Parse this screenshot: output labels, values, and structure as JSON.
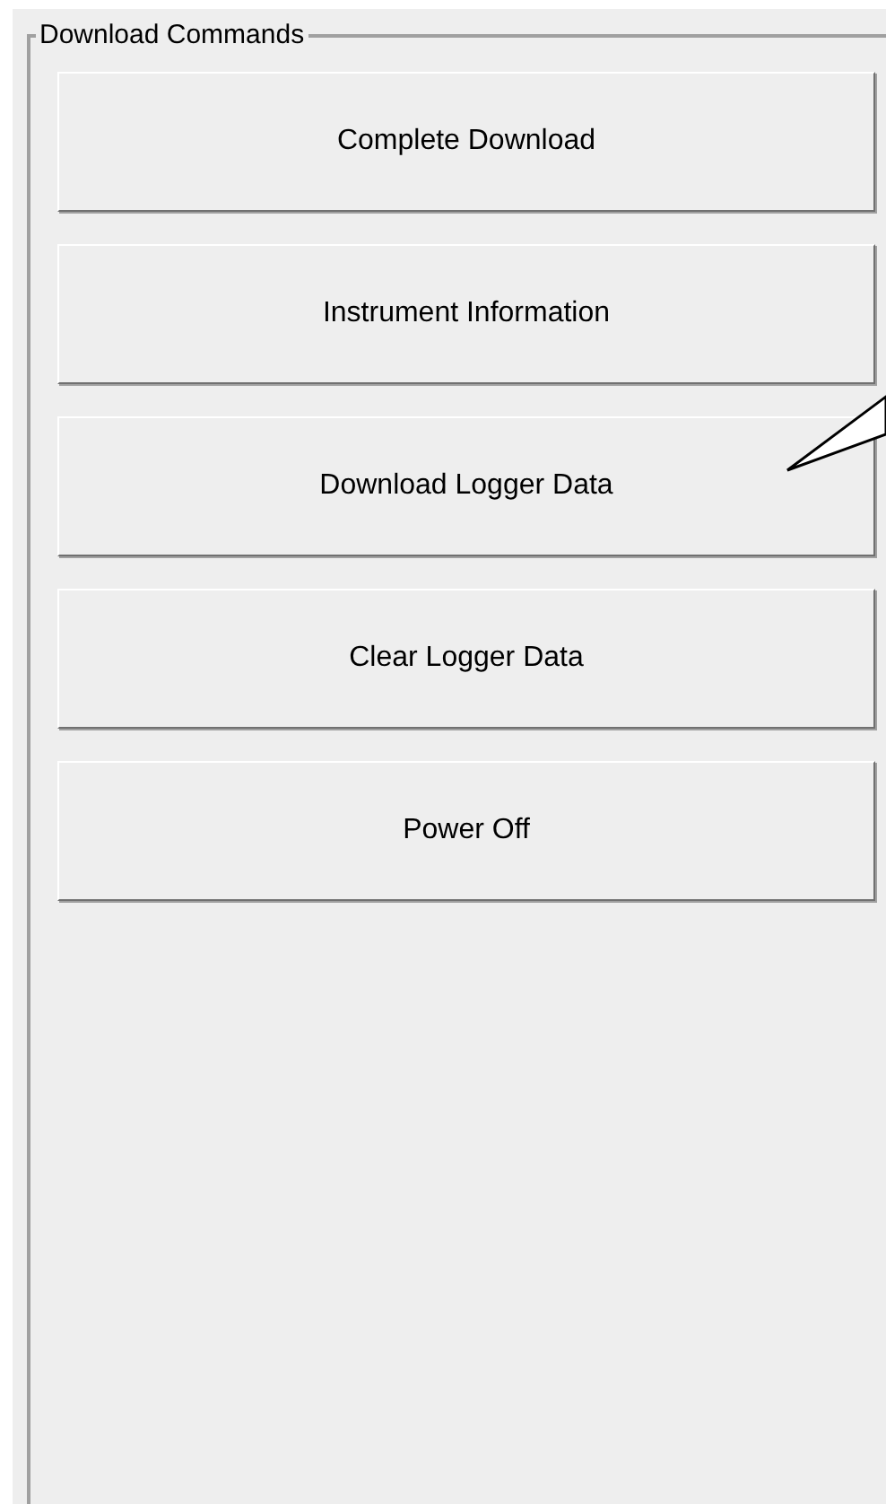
{
  "group": {
    "title": "Download Commands"
  },
  "buttons": [
    {
      "label": "Complete Download"
    },
    {
      "label": "Instrument Information"
    },
    {
      "label": "Download Logger Data"
    },
    {
      "label": "Clear Logger Data"
    },
    {
      "label": "Power Off"
    }
  ]
}
